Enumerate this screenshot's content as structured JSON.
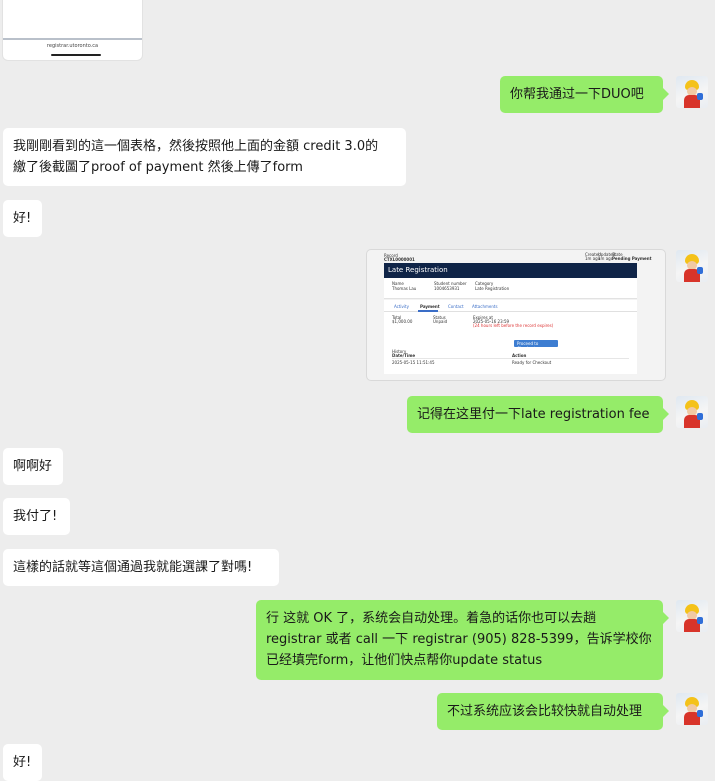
{
  "chat": {
    "top_image": {
      "caption": "registrar.utoronto.ca"
    },
    "messages": [
      {
        "side": "right",
        "text": "你帮我通过一下DUO吧"
      },
      {
        "side": "left",
        "text": "我剛剛看到的這一個表格，然後按照他上面的金額 credit 3.0的\n繳了後截圖了proof of payment 然後上傳了form"
      },
      {
        "side": "left",
        "text": "好!"
      },
      {
        "side": "right",
        "type": "image"
      },
      {
        "side": "right",
        "text": "记得在这里付一下late registration fee"
      },
      {
        "side": "left",
        "text": "啊啊好"
      },
      {
        "side": "left",
        "text": "我付了!"
      },
      {
        "side": "left",
        "text": "這樣的話就等這個通過我就能選課了對嗎!"
      },
      {
        "side": "right",
        "text": "行 这就 OK 了，系统会自动处理。着急的话你也可以去趟\nregistrar 或者 call 一下 registrar (905) 828-5399，告诉学校你\n已经填完form，让他们快点帮你update status"
      },
      {
        "side": "right",
        "text": "不过系统应该会比较快就自动处理"
      },
      {
        "side": "left",
        "text": "好!"
      }
    ],
    "screenshot": {
      "record_label": "Record",
      "record_id": "CTXL0000001",
      "meta": [
        {
          "label": "Created",
          "value": "1m ago"
        },
        {
          "label": "Updated",
          "value": "1m ago"
        },
        {
          "label": "State",
          "value": "Pending Payment"
        }
      ],
      "title": "Late Registration",
      "fields": [
        {
          "label": "Name",
          "value": "Thomas Lau"
        },
        {
          "label": "Student number",
          "value": "1004653931"
        },
        {
          "label": "Category",
          "value": "Late Registration"
        }
      ],
      "tabs": [
        "Activity",
        "Payment",
        "Contact",
        "Attachments"
      ],
      "payment": {
        "total_label": "Total",
        "total_value": "$1,000.00",
        "status_label": "Status",
        "status_value": "Unpaid",
        "expires_label": "Expires at",
        "expires_value": "2025-05-16 23:59",
        "expires_note": "(24 hours left before the record expires)",
        "button": "Proceed to Checkout"
      },
      "history": {
        "label": "History",
        "columns": [
          "Date/Time",
          "Action"
        ],
        "rows": [
          {
            "date": "2025-05-15 11:51:45",
            "action": "Ready for Checkout"
          }
        ]
      }
    }
  }
}
